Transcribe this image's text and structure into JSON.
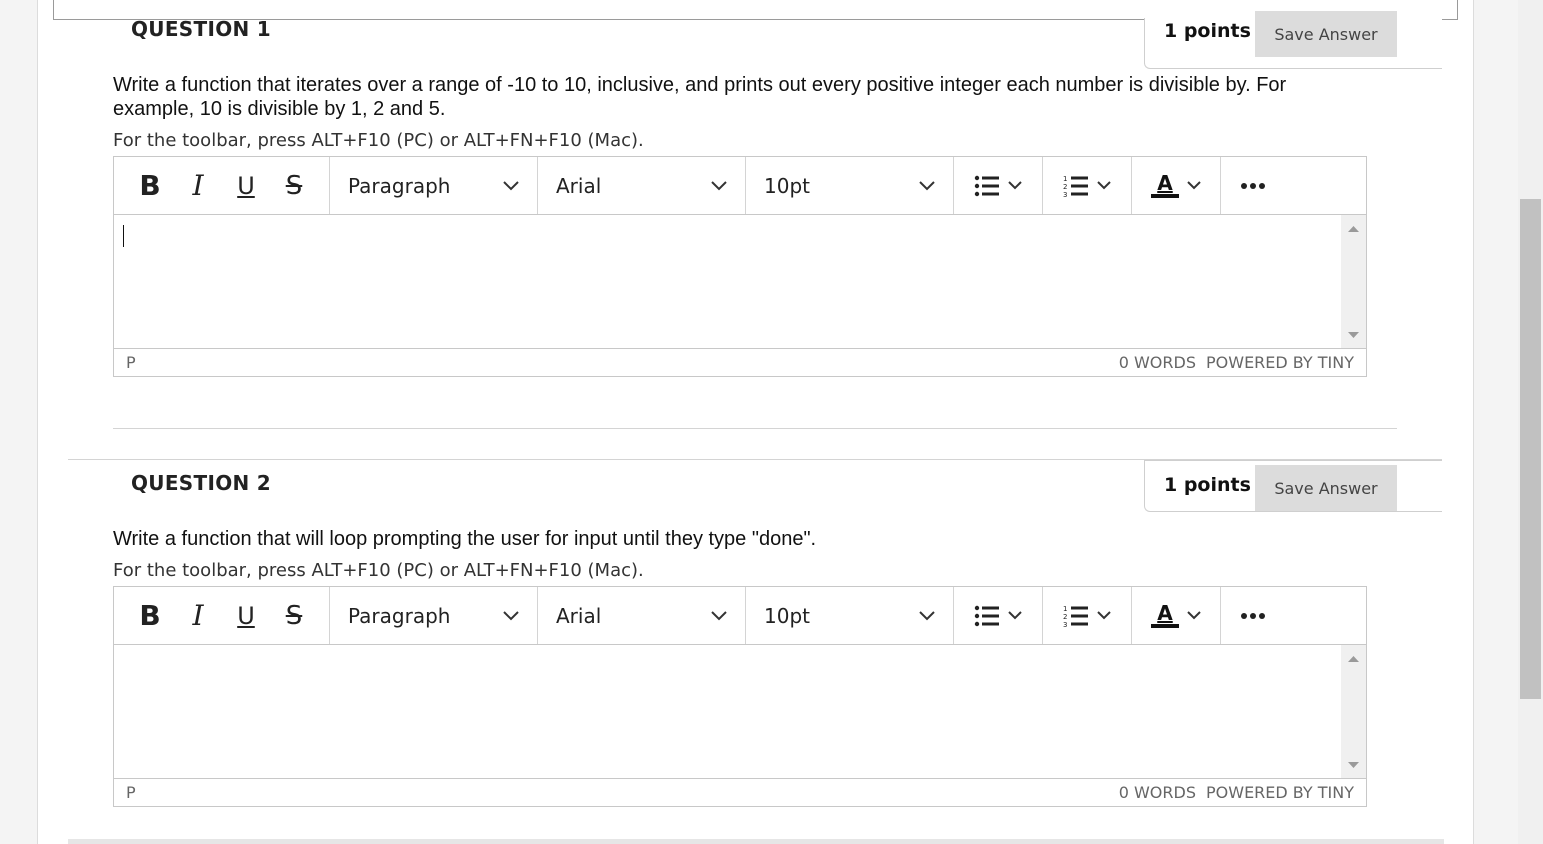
{
  "questions": [
    {
      "title": "QUESTION 1",
      "points": "1 points",
      "save_label": "Save Answer",
      "text": "Write a function that iterates over a range of -10 to 10, inclusive, and prints out every positive integer each number is divisible by. For example, 10 is divisible by 1, 2 and 5.",
      "hint": "For the toolbar, press ALT+F10 (PC) or ALT+FN+F10 (Mac).",
      "editor": {
        "block_format": "Paragraph",
        "font_family": "Arial",
        "font_size": "10pt",
        "status_path": "P",
        "word_count": "0 WORDS",
        "powered_by": "POWERED BY TINY"
      }
    },
    {
      "title": "QUESTION 2",
      "points": "1 points",
      "save_label": "Save Answer",
      "text": "Write a function that will loop prompting the user for input until they type \"done\".",
      "hint": "For the toolbar, press ALT+F10 (PC) or ALT+FN+F10 (Mac).",
      "editor": {
        "block_format": "Paragraph",
        "font_family": "Arial",
        "font_size": "10pt",
        "status_path": "P",
        "word_count": "0 WORDS",
        "powered_by": "POWERED BY TINY"
      }
    }
  ],
  "toolbar_icons": {
    "bold": "B",
    "italic": "I",
    "underline": "U",
    "strikethrough": "S",
    "text_color": "A"
  }
}
